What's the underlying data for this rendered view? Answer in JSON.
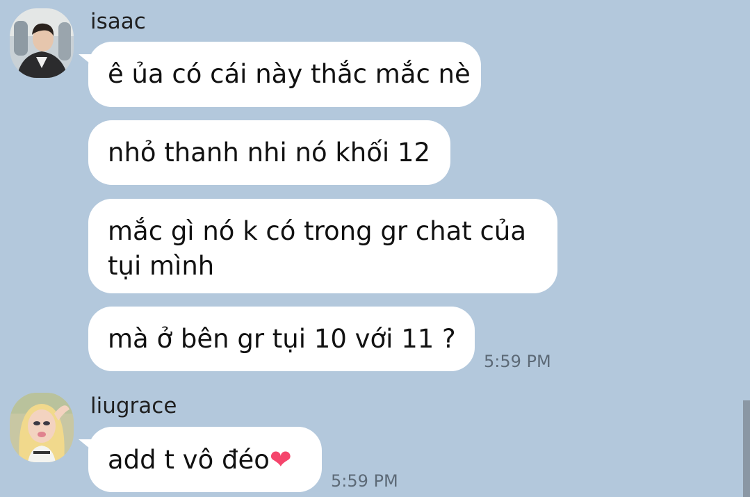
{
  "messages": [
    {
      "sender": "isaac",
      "bubbles": [
        "ê ủa có cái này thắc mắc nè",
        "nhỏ thanh nhi nó khối 12",
        "mắc gì nó k có trong gr chat của tụi mình",
        "mà ở bên gr tụi 10 với 11 ?"
      ],
      "time": "5:59 PM"
    },
    {
      "sender": "liugrace",
      "bubbles": [
        "add t vô đéo"
      ],
      "emoji": "❤",
      "emoji_name": "red-heart-emoji",
      "time": "5:59 PM"
    }
  ],
  "colors": {
    "background": "#b3c8dc",
    "bubble": "#ffffff",
    "timestamp": "#5d6a77"
  }
}
